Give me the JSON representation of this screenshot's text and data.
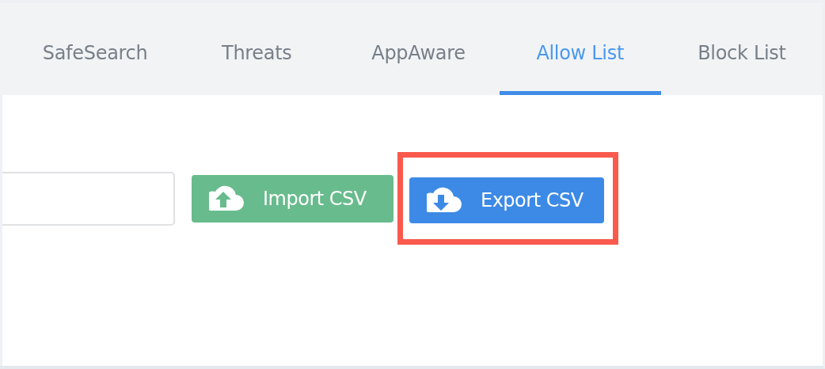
{
  "tabs": [
    {
      "label": "SafeSearch",
      "selected": false
    },
    {
      "label": "Threats",
      "selected": false
    },
    {
      "label": "AppAware",
      "selected": false
    },
    {
      "label": "Allow List",
      "selected": true
    },
    {
      "label": "Block List",
      "selected": false
    }
  ],
  "search_field": {
    "kind": "field"
  },
  "buttons": [
    {
      "label": "Import CSV",
      "kind": "import",
      "highlighted": false
    },
    {
      "label": "Export CSV",
      "kind": "export",
      "highlighted": true
    }
  ]
}
